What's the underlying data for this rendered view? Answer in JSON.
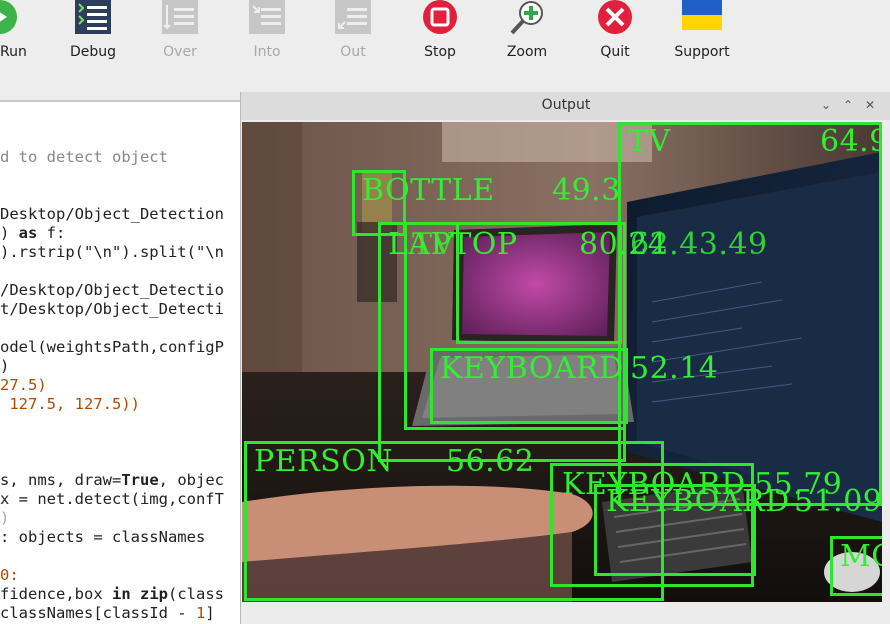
{
  "toolbar": {
    "buttons": [
      {
        "label": "Run",
        "icon": "run-icon",
        "enabled": true
      },
      {
        "label": "Debug",
        "icon": "debug-icon",
        "enabled": true
      },
      {
        "label": "Over",
        "icon": "step-over-icon",
        "enabled": false
      },
      {
        "label": "Into",
        "icon": "step-into-icon",
        "enabled": false
      },
      {
        "label": "Out",
        "icon": "step-out-icon",
        "enabled": false
      },
      {
        "label": "Stop",
        "icon": "stop-icon",
        "enabled": true
      },
      {
        "label": "Zoom",
        "icon": "zoom-icon",
        "enabled": true
      },
      {
        "label": "Quit",
        "icon": "quit-icon",
        "enabled": true
      },
      {
        "label": "Support",
        "icon": "ukraine-flag-icon",
        "enabled": true
      }
    ],
    "run_partial": "Run"
  },
  "editor": {
    "lines": [
      "d to detect object",
      "",
      "Desktop/Object_Detection",
      ") as f:",
      ").rstrip(\"\\n\").split(\"\\n",
      "",
      "/Desktop/Object_Detectio",
      "t/Desktop/Object_Detecti",
      "",
      "odel(weightsPath,configP",
      ")",
      "27.5)",
      " 127.5, 127.5))",
      "",
      "",
      "",
      "s, nms, draw=True, objec",
      "x = net.detect(img,confT",
      ")",
      ": objects = classNames",
      "",
      "0:",
      "fidence,box in zip(class",
      "classNames[classId - 1]"
    ]
  },
  "output_window": {
    "title": "Output",
    "controls": {
      "minimize": "⌄",
      "maximize": "⌃",
      "close": "✕"
    }
  },
  "detections": [
    {
      "label": "TV",
      "score": "64.9"
    },
    {
      "label": "BOTTLE",
      "score": "49.3"
    },
    {
      "label": "LAPTOP",
      "score": "80.24"
    },
    {
      "label": "TV",
      "score": "62.43.49"
    },
    {
      "label": "KEYBOARD",
      "score": "52.14"
    },
    {
      "label": "PERSON",
      "score": "56.62"
    },
    {
      "label": "KEYBOARD",
      "score": "55.79"
    },
    {
      "label": "KEYBOARD",
      "score": "51.09"
    },
    {
      "label": "MO",
      "score": ""
    }
  ],
  "colors": {
    "detection": "#2ee62e",
    "run": "#3cb44a",
    "stop": "#e0203c",
    "quit": "#e0203c",
    "flag_top": "#1f5fc8",
    "flag_bottom": "#ffd500"
  }
}
